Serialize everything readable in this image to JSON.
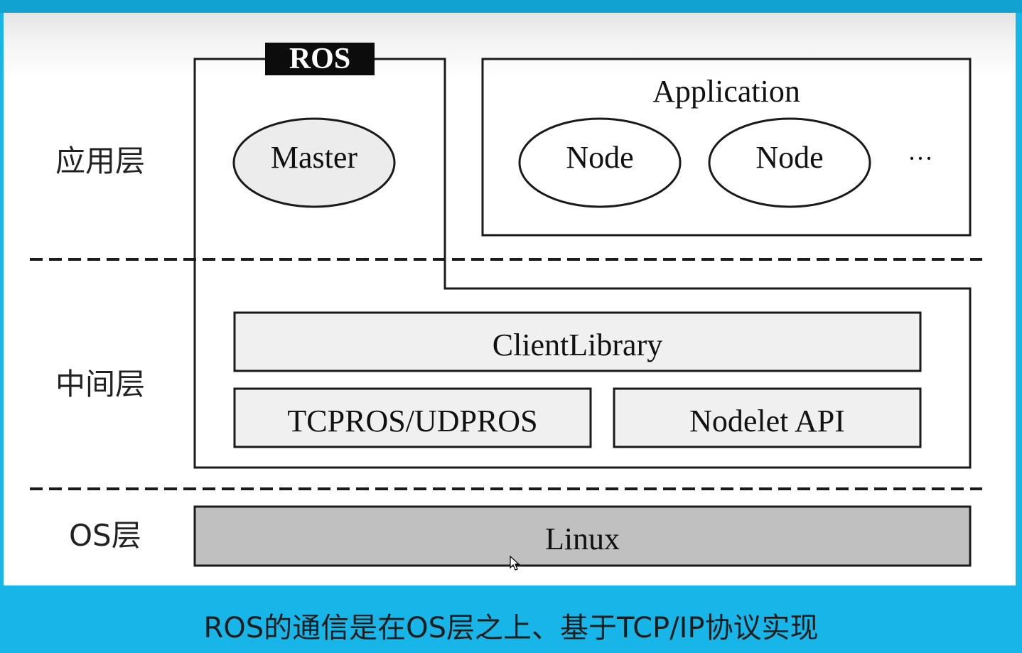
{
  "diagram": {
    "layers": {
      "application": "应用层",
      "middleware": "中间层",
      "os": "OS层"
    },
    "ros_tag": "ROS",
    "master": "Master",
    "application_box": {
      "title": "Application",
      "nodes": [
        "Node",
        "Node"
      ],
      "more": "···"
    },
    "middleware": {
      "client_library": "ClientLibrary",
      "transport": "TCPROS/UDPROS",
      "nodelet": "Nodelet API"
    },
    "os_box": "Linux"
  },
  "caption": "ROS的通信是在OS层之上、基于TCP/IP协议实现",
  "colors": {
    "background": "#18b6e8",
    "top_bar": "#12a2d2",
    "slide": "#ffffff",
    "component_fill": "#f0f0f0",
    "master_fill": "#ececec",
    "os_fill": "#c0c0c0",
    "tag_fill": "#0c0c0c"
  }
}
